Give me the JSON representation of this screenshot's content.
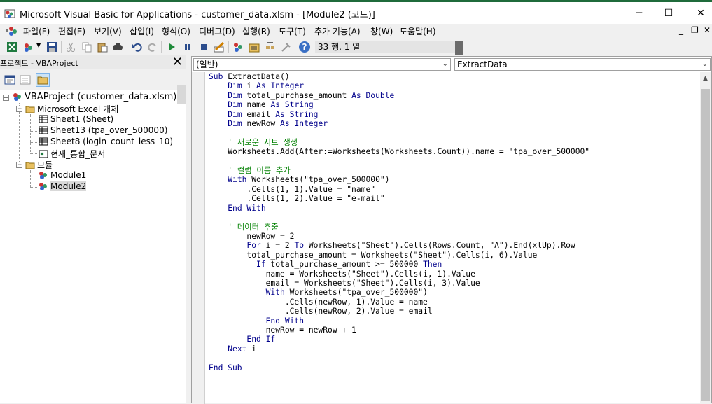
{
  "window": {
    "title": "Microsoft Visual Basic for Applications - customer_data.xlsm - [Module2 (코드)]",
    "minimize": "─",
    "maximize": "☐",
    "close": "✕"
  },
  "menu": {
    "items": [
      "파일(F)",
      "편집(E)",
      "보기(V)",
      "삽입(I)",
      "형식(O)",
      "디버그(D)",
      "실행(R)",
      "도구(T)",
      "추가 기능(A)",
      "창(W)",
      "도움말(H)"
    ],
    "mdi_min": "_",
    "mdi_restore": "❐",
    "mdi_close": "✕"
  },
  "toolbar": {
    "position": "33 행, 1 열",
    "icons": [
      "excel-icon",
      "insert-module-icon",
      "save-icon",
      "cut-icon",
      "copy-icon",
      "paste-icon",
      "find-icon",
      "undo-icon",
      "redo-icon",
      "run-icon",
      "break-icon",
      "reset-icon",
      "design-mode-icon",
      "project-explorer-icon",
      "properties-icon",
      "object-browser-icon",
      "toolbox-icon",
      "help-icon"
    ]
  },
  "project": {
    "header": "프로젝트 - VBAProject",
    "close": "✕",
    "root": "VBAProject (customer_data.xlsm)",
    "folder_objects": "Microsoft Excel 개체",
    "sheets": [
      "Sheet1 (Sheet)",
      "Sheet13 (tpa_over_500000)",
      "Sheet8 (login_count_less_10)"
    ],
    "workbook": "현재_통합_문서",
    "folder_modules": "모듈",
    "modules": [
      "Module1",
      "Module2"
    ],
    "selected": "Module2"
  },
  "code_window": {
    "object_combo": "(일반)",
    "proc_combo": "ExtractData",
    "lines": [
      "Sub ExtractData()",
      "    Dim i As Integer",
      "    Dim total_purchase_amount As Double",
      "    Dim name As String",
      "    Dim email As String",
      "    Dim newRow As Integer",
      "",
      "    ' 새로운 시트 생성",
      "    Worksheets.Add(After:=Worksheets(Worksheets.Count)).name = \"tpa_over_500000\"",
      "",
      "    ' 컬럼 이름 추가",
      "    With Worksheets(\"tpa_over_500000\")",
      "        .Cells(1, 1).Value = \"name\"",
      "        .Cells(1, 2).Value = \"e-mail\"",
      "    End With",
      "",
      "    ' 데이터 추출",
      "        newRow = 2",
      "        For i = 2 To Worksheets(\"Sheet\").Cells(Rows.Count, \"A\").End(xlUp).Row",
      "        total_purchase_amount = Worksheets(\"Sheet\").Cells(i, 6).Value",
      "          If total_purchase_amount >= 500000 Then",
      "            name = Worksheets(\"Sheet\").Cells(i, 1).Value",
      "            email = Worksheets(\"Sheet\").Cells(i, 3).Value",
      "            With Worksheets(\"tpa_over_500000\")",
      "                .Cells(newRow, 1).Value = name",
      "                .Cells(newRow, 2).Value = email",
      "            End With",
      "            newRow = newRow + 1",
      "        End If",
      "    Next i",
      "",
      "End Sub",
      ""
    ]
  }
}
